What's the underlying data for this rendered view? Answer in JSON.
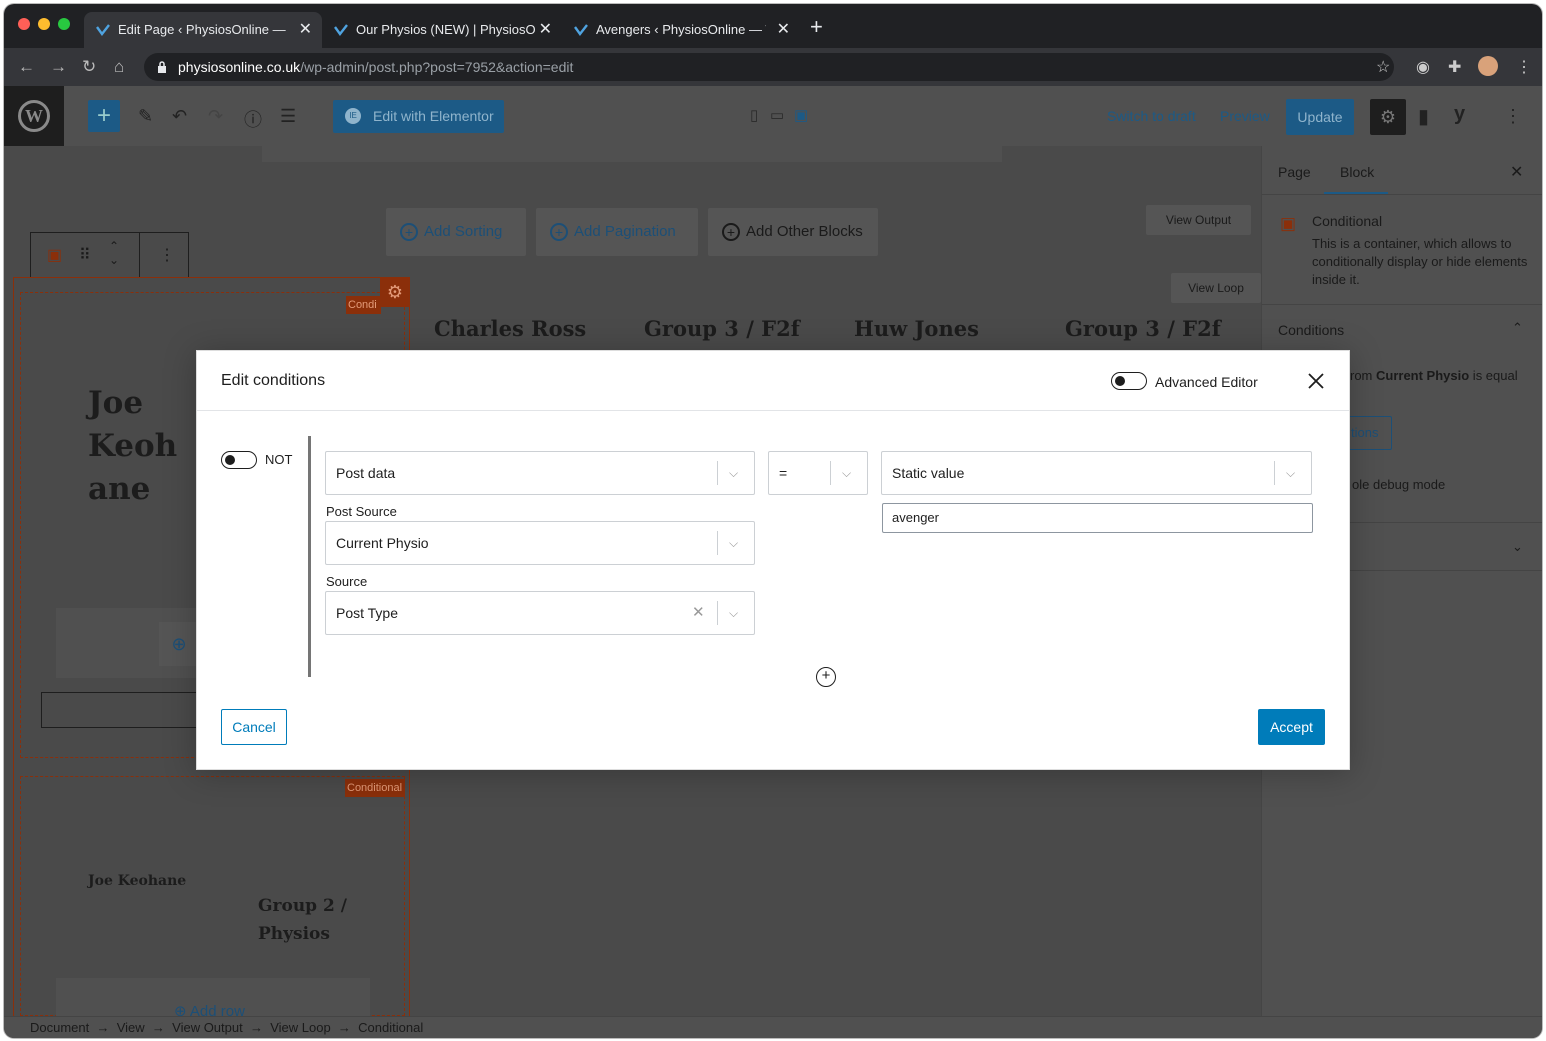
{
  "browser": {
    "tabs": [
      {
        "title": "Edit Page ‹ PhysiosOnline — W",
        "active": true
      },
      {
        "title": "Our Physios (NEW) | PhysiosO",
        "active": false
      },
      {
        "title": "Avengers ‹ PhysiosOnline — W",
        "active": false
      }
    ],
    "url_host": "physiosonline.co.uk",
    "url_path": "/wp-admin/post.php?post=7952&action=edit"
  },
  "toolbar": {
    "edit_elementor": "Edit with Elementor",
    "switch_draft": "Switch to draft",
    "preview": "Preview",
    "update": "Update"
  },
  "sidebar": {
    "tab_page": "Page",
    "tab_block": "Block",
    "block_title": "Conditional",
    "block_desc": "This is a container, which allows to conditionally display or hide elements inside it.",
    "conditions_title": "Conditions",
    "cond_text_pre": "rom ",
    "cond_text_bold": "Current Physio",
    "cond_text_post": " is equal",
    "edit_btn_partial": "tions",
    "debug_partial": "ole debug mode"
  },
  "canvas": {
    "add_sorting": "Add Sorting",
    "add_pagination": "Add Pagination",
    "add_other": "Add Other Blocks",
    "view_output": "View Output",
    "view_loop": "View Loop",
    "cond_badge_1": "Condi",
    "cond_badge_2": "Conditional",
    "headings": [
      "Charles Ross",
      "Group 3 / F2f",
      "Huw Jones",
      "Group 3 / F2f"
    ],
    "name_big_lines": [
      "Joe",
      "Keoh",
      "ane"
    ],
    "name_small": "Joe Keohane",
    "group_lines": [
      "Group 2 /",
      "Physios"
    ],
    "add_row": "Add row"
  },
  "footer": {
    "breadcrumb": [
      "Document",
      "View",
      "View Output",
      "View Loop",
      "Conditional"
    ]
  },
  "modal": {
    "title": "Edit conditions",
    "advanced_editor": "Advanced Editor",
    "not_label": "NOT",
    "data_select": "Post data",
    "operator_select": "=",
    "value_type_select": "Static value",
    "value_input": "avenger",
    "post_source_label": "Post Source",
    "post_source_value": "Current Physio",
    "source_label": "Source",
    "source_value": "Post Type",
    "cancel": "Cancel",
    "accept": "Accept"
  },
  "colors": {
    "accent": "#007cba",
    "conditional_orange": "#c74f17"
  }
}
